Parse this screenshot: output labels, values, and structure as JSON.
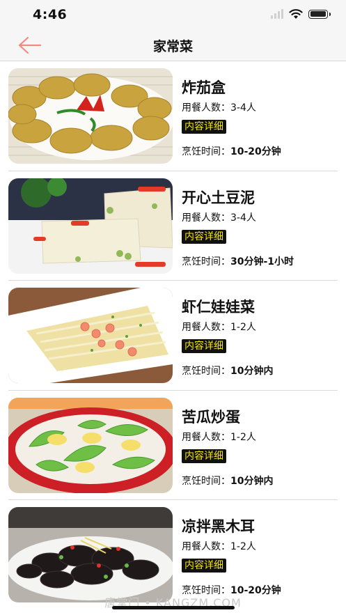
{
  "status": {
    "time": "4:46"
  },
  "nav": {
    "title": "家常菜"
  },
  "labels": {
    "servings_prefix": "用餐人数：",
    "detail": "内容详细",
    "cook_prefix": "烹饪时间："
  },
  "dishes": [
    {
      "name": "炸茄盒",
      "servings": "3-4人",
      "time": "10-20分钟"
    },
    {
      "name": "开心土豆泥",
      "servings": "3-4人",
      "time": "30分钟-1小时"
    },
    {
      "name": "虾仁娃娃菜",
      "servings": "1-2人",
      "time": "10分钟内"
    },
    {
      "name": "苦瓜炒蛋",
      "servings": "1-2人",
      "time": "10分钟内"
    },
    {
      "name": "凉拌黑木耳",
      "servings": "1-2人",
      "time": "10-20分钟"
    }
  ],
  "watermark": "唐堂门 • KANGZM.COM",
  "colors": {
    "accent_back": "#f08a84",
    "tag_bg": "#111111",
    "tag_text": "#f5e400"
  }
}
